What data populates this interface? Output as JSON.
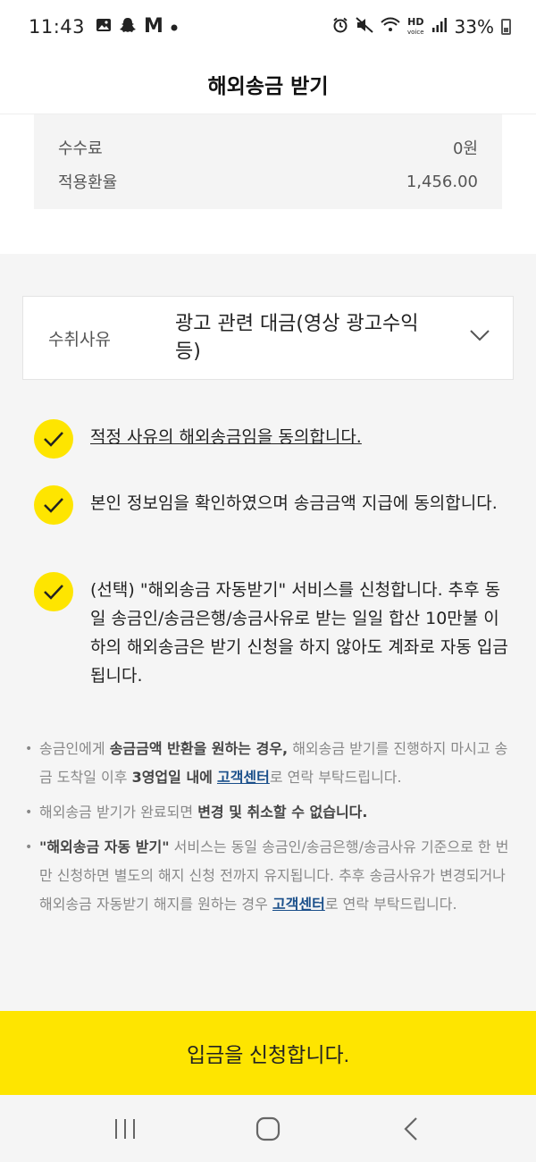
{
  "status_bar": {
    "time": "11:43",
    "battery": "33%",
    "left_icons": [
      "gallery-icon",
      "snapchat-icon",
      "gmail-icon",
      "dot-icon"
    ],
    "right_icons": [
      "alarm-icon",
      "mute-icon",
      "wifi-icon",
      "hd-voice-icon",
      "signal-icon",
      "battery-icon"
    ]
  },
  "header": {
    "title": "해외송금 받기"
  },
  "fees": {
    "rows": [
      {
        "label": "수수료",
        "value": "0원"
      },
      {
        "label": "적용환율",
        "value": "1,456.00"
      }
    ]
  },
  "reason": {
    "label": "수취사유",
    "value": "광고 관련 대금(영상 광고수익 등)"
  },
  "checks": [
    {
      "text": "적정 사유의 해외송금임을 동의합니다.",
      "checked": true
    },
    {
      "text": "본인 정보임을 확인하였으며 송금금액 지급에 동의합니다.",
      "checked": true
    },
    {
      "text": "(선택) \"해외송금 자동받기\" 서비스를 신청합니다. 추후 동일 송금인/송금은행/송금사유로 받는 일일 합산 10만불 이하의 해외송금은 받기 신청을 하지 않아도 계좌로 자동 입금됩니다.",
      "checked": true
    }
  ],
  "notices": {
    "n1": {
      "pre": "송금인에게 ",
      "bold1": "송금금액 반환을 원하는 경우,",
      "mid": " 해외송금 받기를 진행하지 마시고 송금 도착일 이후 ",
      "bold2": "3영업일 내에",
      "space": " ",
      "link": "고객센터",
      "post": "로 연락 부탁드립니다."
    },
    "n2": {
      "pre": "해외송금 받기가 완료되면 ",
      "bold": "변경 및 취소할 수 없습니다."
    },
    "n3": {
      "bold": "\"해외송금 자동 받기\"",
      "mid": " 서비스는 동일 송금인/송금은행/송금사유 기준으로 한 번만 신청하면 별도의 해지 신청 전까지 유지됩니다. 추후 송금사유가 변경되거나 해외송금 자동받기 해지를 원하는 경우 ",
      "link": "고객센터",
      "post": "로 연락 부탁드립니다."
    }
  },
  "cta": {
    "label": "입금을 신청합니다."
  },
  "nav": {
    "items": [
      "recent-apps",
      "home",
      "back"
    ]
  },
  "colors": {
    "accent": "#fee500",
    "link": "#1a4f8a"
  }
}
